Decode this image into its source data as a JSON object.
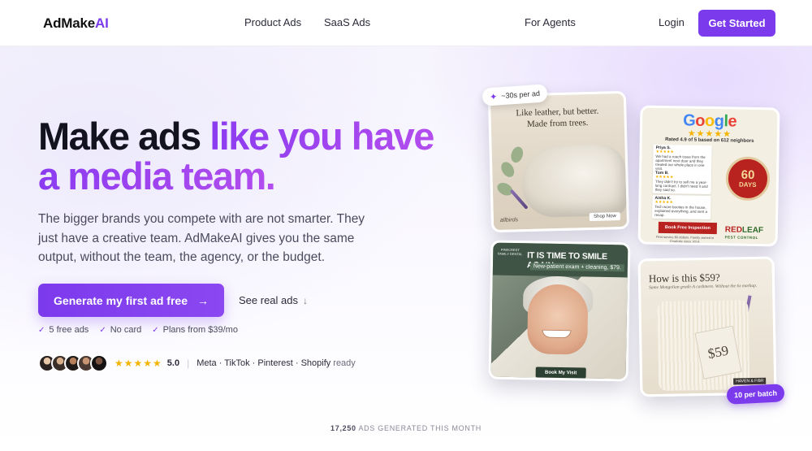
{
  "nav": {
    "logo_main": "AdMake",
    "logo_accent": "AI",
    "links": [
      "Product Ads",
      "SaaS Ads",
      "For Agents"
    ],
    "login": "Login",
    "cta": "Get Started"
  },
  "hero": {
    "headline_dark": "Make ads",
    "headline_accent_1": "like you have",
    "headline_accent_2": "a media team.",
    "subtext": "The bigger brands you compete with are not smarter. They just have a creative team. AdMakeAI gives you the same output, without the team, the agency, or the budget.",
    "primary_cta": "Generate my first ad free",
    "secondary_cta": "See real ads",
    "checks": [
      "5 free ads",
      "No card",
      "Plans from $39/mo"
    ],
    "rating": "5.0",
    "platforms": "Meta · TikTok · Pinterest · Shopify",
    "platforms_suffix": "ready"
  },
  "cards": {
    "time_badge": "~30s per ad",
    "batch_badge": "10 per batch",
    "shoe": {
      "headline_1": "Like leather, but better.",
      "headline_2": "Made from trees.",
      "brand": "allbirds",
      "shop": "Shop Now"
    },
    "google": {
      "logo": "Google",
      "rated": "Rated 4.9 of 5  based on 612 neighbors",
      "reviews": [
        {
          "name": "Priya S.",
          "text": "We had a roach issue from the apartment next door and they treated our whole place in one visit."
        },
        {
          "name": "Tom B.",
          "text": "They didn't try to sell me a year-long contract. I didn't need it and they said so."
        },
        {
          "name": "Aisha K.",
          "text": "Tech wore booties in the house, explained everything, and sent a recap."
        }
      ],
      "seal_number": "60",
      "seal_days": "DAYS",
      "book": "Book Free Inspection",
      "foot": "First service $0 dollars. Family owned in Charlotte since 2014.",
      "brand_1": "RED",
      "brand_2": "LEAF",
      "brand_sub": "PEST CONTROL"
    },
    "dental": {
      "logo": "PINECREST FAMILY DENTAL",
      "headline": "IT IS TIME TO SMILE AGAIN.",
      "sub": "New-patient exam + cleaning, $79.",
      "book": "Book My Visit"
    },
    "sweater": {
      "headline": "How is this $59?",
      "sub": "Same Mongolian grade-A cashmere. Without the 6x markup.",
      "price": "$59",
      "brand": "HAVEN & FIBR"
    }
  },
  "counter": {
    "number": "17,250",
    "label": "ADS GENERATED THIS MONTH"
  },
  "colors": {
    "accent": "#7c3aed",
    "star": "#f5b400"
  }
}
